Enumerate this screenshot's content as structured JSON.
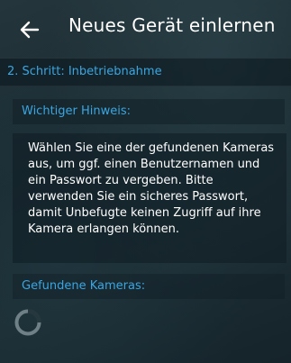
{
  "header": {
    "title": "Neues Gerät einlernen",
    "back_icon": "arrow-left-icon"
  },
  "step": {
    "label": "2. Schritt: Inbetriebnahme"
  },
  "notice": {
    "heading": "Wichtiger Hinweis:",
    "text": "Wählen Sie eine der gefundenen Kameras aus, um ggf. einen Benutzernamen und ein Passwort zu vergeben. Bitte verwenden Sie ein sicheres Passwort, damit Unbefugte keinen Zugriff auf ihre Kamera erlangen können."
  },
  "cameras": {
    "heading": "Gefundene Kameras:",
    "loading_icon": "loading-spinner-icon"
  },
  "colors": {
    "accent": "#39a6e3",
    "text": "#ffffff",
    "background": "#1c2d33"
  }
}
